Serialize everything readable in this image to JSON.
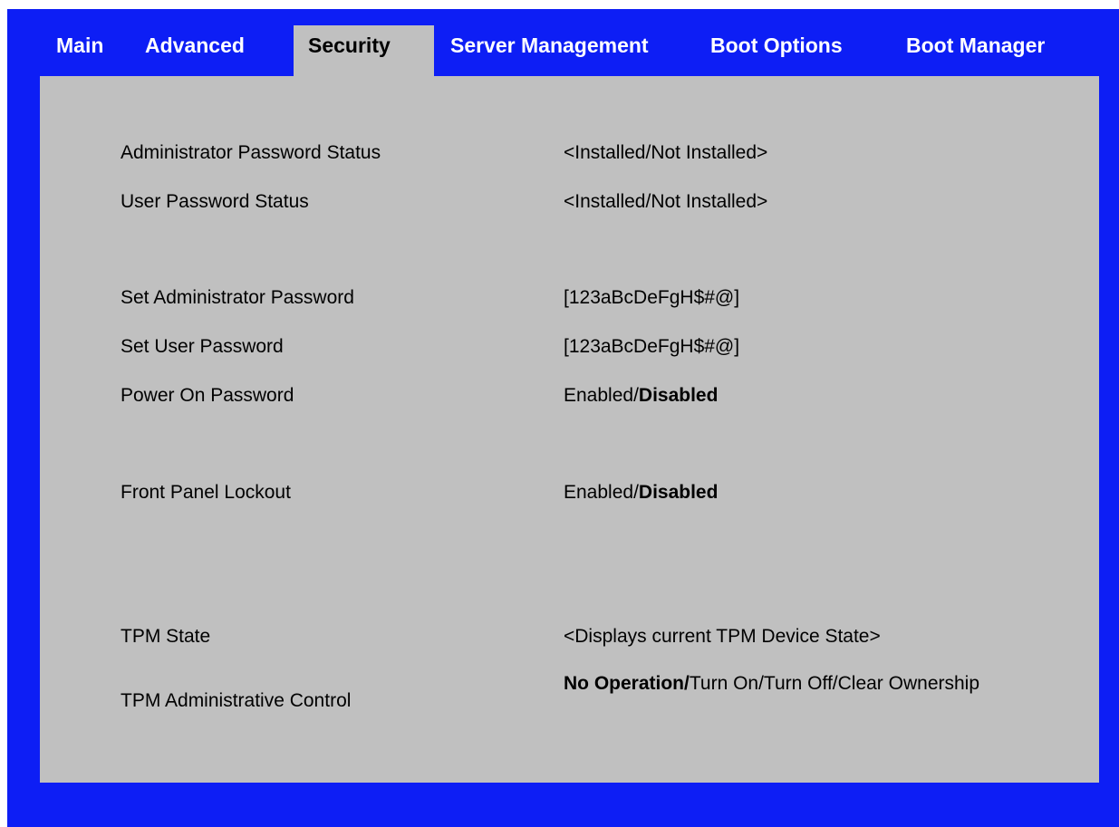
{
  "tabs": [
    {
      "label": "Main"
    },
    {
      "label": "Advanced"
    },
    {
      "label": "Security"
    },
    {
      "label": "Server Management"
    },
    {
      "label": "Boot Options"
    },
    {
      "label": "Boot Manager"
    }
  ],
  "active_tab": "Security",
  "settings": {
    "admin_status": {
      "label": "Administrator Password Status",
      "value": "<Installed/Not Installed>"
    },
    "user_status": {
      "label": "User Password Status",
      "value": "<Installed/Not Installed>"
    },
    "set_admin": {
      "label": "Set Administrator Password",
      "value": "[123aBcDeFgH$#@]"
    },
    "set_user": {
      "label": "Set User Password",
      "value": "[123aBcDeFgH$#@]"
    },
    "power_on": {
      "label": "Power On Password",
      "value_plain": "Enabled/",
      "value_bold": "Disabled"
    },
    "front_panel": {
      "label": "Front Panel Lockout",
      "value_plain": "Enabled/",
      "value_bold": "Disabled"
    },
    "tpm_state": {
      "label": "TPM State",
      "value": "<Displays current TPM Device State>"
    },
    "tpm_admin": {
      "label": "TPM Administrative Control",
      "value_bold": "No Operation/",
      "value_plain": "Turn On/Turn Off/Clear Ownership"
    }
  },
  "colors": {
    "frame": "#0d1ef5",
    "panel": "#c0c0c0"
  }
}
